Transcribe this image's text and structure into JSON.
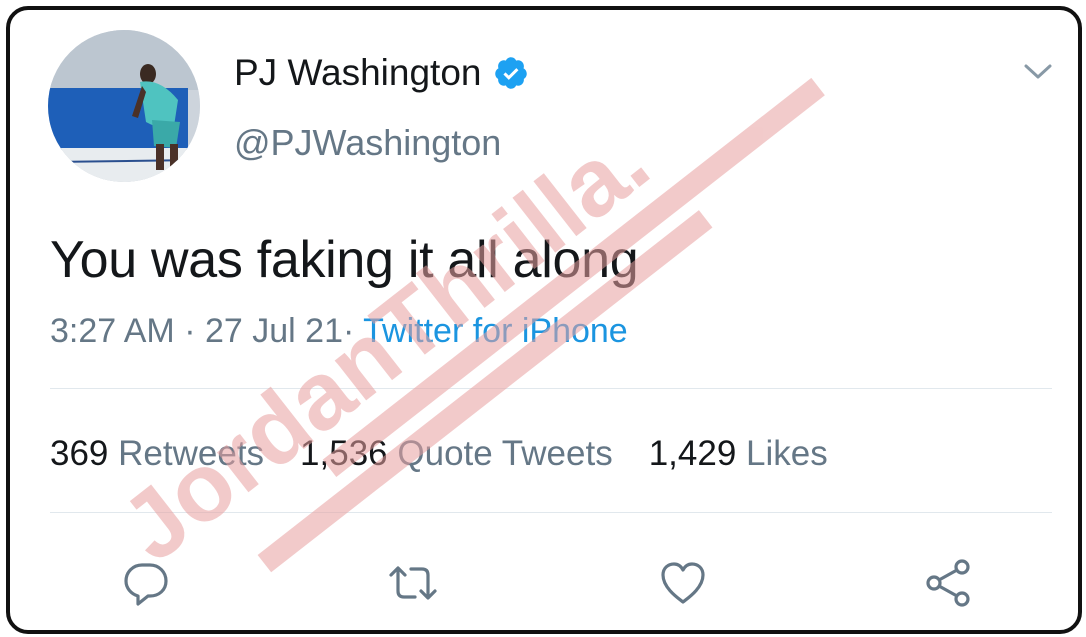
{
  "tweet": {
    "author": {
      "display_name": "PJ Washington",
      "handle": "@PJWashington",
      "verified": true
    },
    "text": "You was faking it all along",
    "time": "3:27 AM",
    "date": "27 Jul 21",
    "separator": "·",
    "source": "Twitter for iPhone",
    "stats": [
      {
        "count": "369",
        "label": "Retweets"
      },
      {
        "count": "1,536",
        "label": "Quote Tweets"
      },
      {
        "count": "1,429",
        "label": "Likes"
      }
    ]
  },
  "watermark": {
    "text": "JordanThrilla."
  },
  "colors": {
    "text": "#14171a",
    "secondary": "#657786",
    "link": "#1b95e0",
    "verified": "#1da1f2",
    "divider": "#e1e8ed",
    "watermark": "#e8a0a0"
  },
  "icons": [
    "verified-icon",
    "chevron-down-icon",
    "reply-icon",
    "retweet-icon",
    "like-icon",
    "share-icon"
  ]
}
